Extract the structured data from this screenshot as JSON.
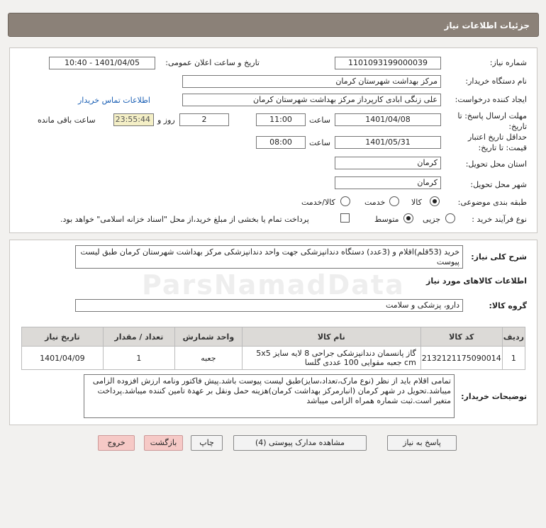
{
  "header": {
    "title": "جزئیات اطلاعات نیاز"
  },
  "form": {
    "need_number": {
      "label": "شماره نیاز:",
      "value": "1101093199000039"
    },
    "announce": {
      "label": "تاریخ و ساعت اعلان عمومی:",
      "value": "1401/04/05 - 10:40"
    },
    "buyer": {
      "label": "نام دستگاه خریدار:",
      "value": "مرکز بهداشت شهرستان کرمان"
    },
    "creator": {
      "label": "ایجاد کننده درخواست:",
      "value": "علی زنگی ابادی کارپرداز مرکز بهداشت شهرستان کرمان",
      "contact_link": "اطلاعات تماس خریدار"
    },
    "deadline": {
      "label": "مهلت ارسال پاسخ: تا تاریخ:",
      "date": "1401/04/08",
      "time_label": "ساعت",
      "time": "11:00",
      "days": "2",
      "days_label": "روز و",
      "remaining": "23:55:44",
      "remaining_label": "ساعت باقی مانده"
    },
    "validity": {
      "label": "حداقل تاریخ اعتبار قیمت: تا تاریخ:",
      "date": "1401/05/31",
      "time_label": "ساعت",
      "time": "08:00"
    },
    "province": {
      "label": "استان محل تحویل:",
      "value": "کرمان"
    },
    "city": {
      "label": "شهر محل تحویل:",
      "value": "کرمان"
    },
    "category": {
      "label": "طبقه بندی موضوعی:",
      "options": [
        "کالا",
        "خدمت",
        "کالا/خدمت"
      ]
    },
    "purchase_type": {
      "label": "نوع فرآیند خرید :",
      "options": [
        "جزیی",
        "متوسط"
      ],
      "payment_note": "پرداخت تمام یا بخشی از مبلغ خرید،از محل \"اسناد خزانه اسلامی\" خواهد بود."
    }
  },
  "description": {
    "label": "شرح کلی نیاز:",
    "text": "خرید (53قلم)اقلام و (3عدد) دستگاه دندانپزشکی جهت واحد دندانپزشکی مرکز بهداشت شهرستان کرمان طبق لیست پیوست"
  },
  "goods": {
    "section_title": "اطلاعات کالاهای مورد نیاز",
    "group_label": "گروه کالا:",
    "group_value": "دارو، پزشکی و سلامت",
    "columns": [
      "ردیف",
      "کد کالا",
      "نام کالا",
      "واحد شمارش",
      "تعداد / مقدار",
      "تاریخ نیاز"
    ],
    "rows": [
      {
        "index": "1",
        "code": "2132121175090014",
        "name": "گاز پانسمان دندانپزشکی جراحی 8 لایه سایز 5x5 cm جعبه مقوایی 100 عددی گلسا",
        "unit": "جعبه",
        "qty": "1",
        "date": "1401/04/09"
      }
    ]
  },
  "notes": {
    "label": "توضیحات خریدار:",
    "text": "تمامی اقلام باید از نظر (نوع مارک،تعداد،سایز)طبق لیست پیوست باشد.پیش فاکتور ونامه ارزش افزوده الزامی میباشد.تحویل در شهر کرمان (انبارمرکز بهداشت کرمان)هزینه حمل ونقل بر عهدة تامین کننده میباشد.پرداخت متغیر است.ثبت شماره همراه الزامی میباشد"
  },
  "buttons": {
    "reply": "پاسخ به نیاز",
    "attachments": "مشاهده مدارک پیوستی (4)",
    "print": "چاپ",
    "back": "بازگشت",
    "exit": "خروج"
  },
  "watermark": "ParsNamadData"
}
